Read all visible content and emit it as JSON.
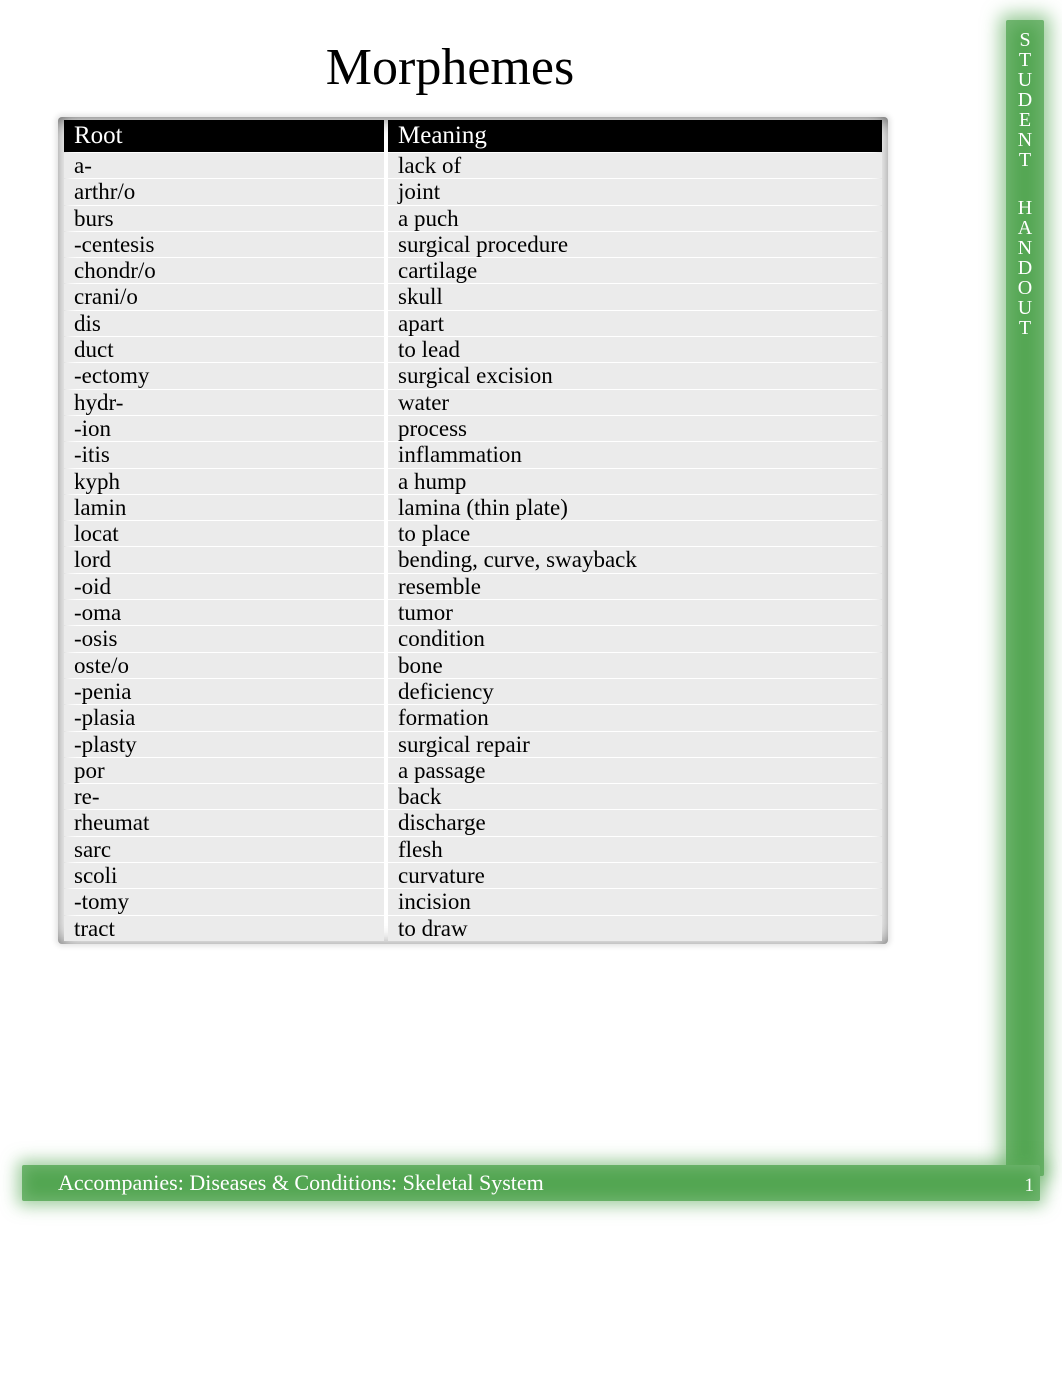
{
  "title": "Morphemes",
  "sidebar_label_1": "STUDENT",
  "sidebar_label_2": "HANDOUT",
  "footer_text": "Accompanies: Diseases & Conditions: Skeletal System",
  "page_number": "1",
  "table": {
    "headers": {
      "root": "Root",
      "meaning": "Meaning"
    },
    "rows": [
      {
        "root": "a-",
        "meaning": "lack of"
      },
      {
        "root": "arthr/o",
        "meaning": "joint"
      },
      {
        "root": "burs",
        "meaning": "a puch"
      },
      {
        "root": "-centesis",
        "meaning": "surgical procedure"
      },
      {
        "root": "chondr/o",
        "meaning": "cartilage"
      },
      {
        "root": "crani/o",
        "meaning": "skull"
      },
      {
        "root": "dis",
        "meaning": "apart"
      },
      {
        "root": "duct",
        "meaning": "to lead"
      },
      {
        "root": "-ectomy",
        "meaning": "surgical excision"
      },
      {
        "root": "hydr-",
        "meaning": "water"
      },
      {
        "root": "-ion",
        "meaning": "process"
      },
      {
        "root": "-itis",
        "meaning": "inflammation"
      },
      {
        "root": "kyph",
        "meaning": "a hump"
      },
      {
        "root": "lamin",
        "meaning": "lamina (thin plate)"
      },
      {
        "root": "locat",
        "meaning": "to place"
      },
      {
        "root": "lord",
        "meaning": "bending, curve, swayback"
      },
      {
        "root": "-oid",
        "meaning": "resemble"
      },
      {
        "root": "-oma",
        "meaning": "tumor"
      },
      {
        "root": "-osis",
        "meaning": "condition"
      },
      {
        "root": "oste/o",
        "meaning": "bone"
      },
      {
        "root": "-penia",
        "meaning": "deficiency"
      },
      {
        "root": "-plasia",
        "meaning": "formation"
      },
      {
        "root": "-plasty",
        "meaning": "surgical repair"
      },
      {
        "root": "por",
        "meaning": "a passage"
      },
      {
        "root": "re-",
        "meaning": "back"
      },
      {
        "root": "rheumat",
        "meaning": "discharge"
      },
      {
        "root": "sarc",
        "meaning": "flesh"
      },
      {
        "root": "scoli",
        "meaning": "curvature"
      },
      {
        "root": "-tomy",
        "meaning": "incision"
      },
      {
        "root": "tract",
        "meaning": "to draw"
      }
    ]
  }
}
